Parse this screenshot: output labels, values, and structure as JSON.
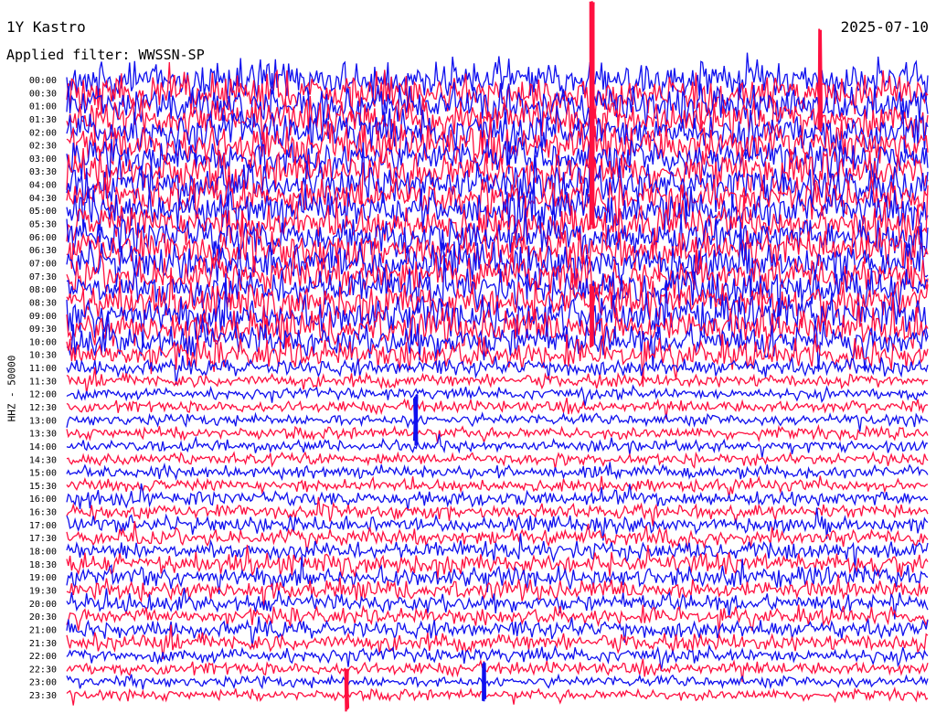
{
  "header": {
    "station": "1Y Kastro",
    "date": "2025-07-10",
    "filter": "Applied filter: WWSSN-SP",
    "channel_label": "HHZ - 50000"
  },
  "colors": {
    "blue": "#1010ee",
    "red": "#ff1040"
  },
  "chart_data": {
    "type": "line",
    "kind": "helicorder",
    "title": "1Y Kastro",
    "ylabel": "HHZ - 50000",
    "row_labels": [
      "00:00",
      "00:30",
      "01:00",
      "01:30",
      "02:00",
      "02:30",
      "03:00",
      "03:30",
      "04:00",
      "04:30",
      "05:00",
      "05:30",
      "06:00",
      "06:30",
      "07:00",
      "07:30",
      "08:00",
      "08:30",
      "09:00",
      "09:30",
      "10:00",
      "10:30",
      "11:00",
      "11:30",
      "12:00",
      "12:30",
      "13:00",
      "13:30",
      "14:00",
      "14:30",
      "15:00",
      "15:30",
      "16:00",
      "16:30",
      "17:00",
      "17:30",
      "18:00",
      "18:30",
      "19:00",
      "19:30",
      "20:00",
      "20:30",
      "21:00",
      "21:30",
      "22:00",
      "22:30",
      "23:00",
      "23:30"
    ],
    "row_colors_cycle": [
      "blue",
      "red"
    ],
    "row_amplitude": [
      1.8,
      1.9,
      1.9,
      1.8,
      1.9,
      1.9,
      1.8,
      1.9,
      1.9,
      1.8,
      1.9,
      1.8,
      1.8,
      1.9,
      1.8,
      1.8,
      1.9,
      1.8,
      1.9,
      1.8,
      1.6,
      1.4,
      0.8,
      0.6,
      0.55,
      0.55,
      0.55,
      0.55,
      0.55,
      0.55,
      0.6,
      0.6,
      0.7,
      0.7,
      0.75,
      0.75,
      0.9,
      1.0,
      1.0,
      0.95,
      0.85,
      0.8,
      0.85,
      0.8,
      0.7,
      0.6,
      0.55,
      0.5
    ],
    "spikes": [
      {
        "row": 0,
        "t": 0.61,
        "amp": 6.0,
        "series": "red"
      },
      {
        "row": 0,
        "t": 0.875,
        "amp": 4.0,
        "series": "red"
      },
      {
        "row": 8,
        "t": 0.61,
        "amp": 3.5,
        "series": "red"
      },
      {
        "row": 18,
        "t": 0.61,
        "amp": 2.5,
        "series": "red"
      },
      {
        "row": 26,
        "t": 0.405,
        "amp": 2.0,
        "series": "blue"
      },
      {
        "row": 46,
        "t": 0.485,
        "amp": 1.6,
        "series": "blue"
      },
      {
        "row": 47,
        "t": 0.325,
        "amp": 2.0,
        "series": "red"
      }
    ]
  }
}
